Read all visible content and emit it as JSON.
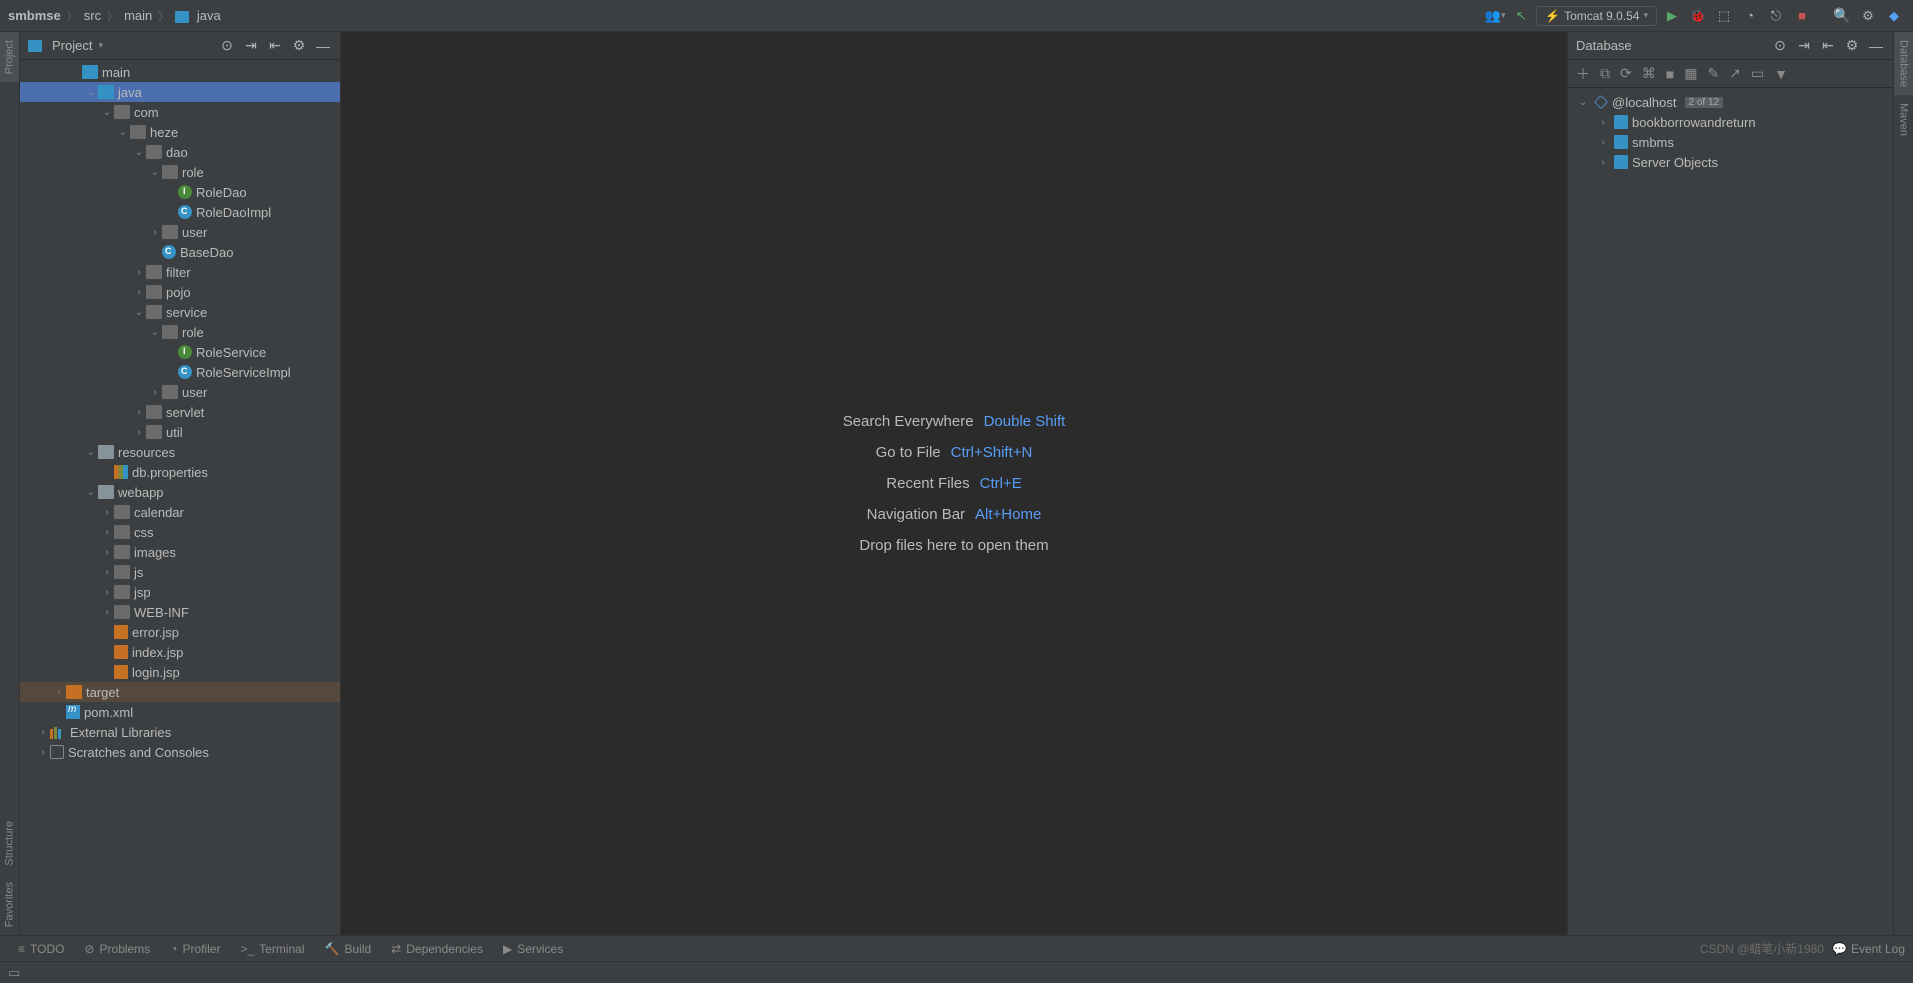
{
  "breadcrumb": {
    "project": "smbmse",
    "parts": [
      "src",
      "main"
    ],
    "current": "java"
  },
  "runConfig": {
    "label": "Tomcat 9.0.54"
  },
  "projectPanel": {
    "title": "Project",
    "tree": [
      {
        "label": "main",
        "indent": 3,
        "arrow": "",
        "iconCls": "icon-folder-blue",
        "hidden_top": true
      },
      {
        "label": "java",
        "indent": 4,
        "arrow": "v",
        "iconCls": "icon-folder-blue",
        "selected": true
      },
      {
        "label": "com",
        "indent": 5,
        "arrow": "v",
        "iconCls": "icon-folder-dark"
      },
      {
        "label": "heze",
        "indent": 6,
        "arrow": "v",
        "iconCls": "icon-folder-dark"
      },
      {
        "label": "dao",
        "indent": 7,
        "arrow": "v",
        "iconCls": "icon-folder-dark"
      },
      {
        "label": "role",
        "indent": 8,
        "arrow": "v",
        "iconCls": "icon-folder-dark"
      },
      {
        "label": "RoleDao",
        "indent": 9,
        "arrow": "",
        "iconCls": "icon-interface"
      },
      {
        "label": "RoleDaoImpl",
        "indent": 9,
        "arrow": "",
        "iconCls": "icon-class"
      },
      {
        "label": "user",
        "indent": 8,
        "arrow": ">",
        "iconCls": "icon-folder-dark"
      },
      {
        "label": "BaseDao",
        "indent": 8,
        "arrow": "",
        "iconCls": "icon-class"
      },
      {
        "label": "filter",
        "indent": 7,
        "arrow": ">",
        "iconCls": "icon-folder-dark"
      },
      {
        "label": "pojo",
        "indent": 7,
        "arrow": ">",
        "iconCls": "icon-folder-dark"
      },
      {
        "label": "service",
        "indent": 7,
        "arrow": "v",
        "iconCls": "icon-folder-dark"
      },
      {
        "label": "role",
        "indent": 8,
        "arrow": "v",
        "iconCls": "icon-folder-dark"
      },
      {
        "label": "RoleService",
        "indent": 9,
        "arrow": "",
        "iconCls": "icon-interface"
      },
      {
        "label": "RoleServiceImpl",
        "indent": 9,
        "arrow": "",
        "iconCls": "icon-class"
      },
      {
        "label": "user",
        "indent": 8,
        "arrow": ">",
        "iconCls": "icon-folder-dark"
      },
      {
        "label": "servlet",
        "indent": 7,
        "arrow": ">",
        "iconCls": "icon-folder-dark"
      },
      {
        "label": "util",
        "indent": 7,
        "arrow": ">",
        "iconCls": "icon-folder-dark"
      },
      {
        "label": "resources",
        "indent": 4,
        "arrow": "v",
        "iconCls": "icon-folder"
      },
      {
        "label": "db.properties",
        "indent": 5,
        "arrow": "",
        "iconCls": "icon-props"
      },
      {
        "label": "webapp",
        "indent": 4,
        "arrow": "v",
        "iconCls": "icon-folder"
      },
      {
        "label": "calendar",
        "indent": 5,
        "arrow": ">",
        "iconCls": "icon-folder-dark"
      },
      {
        "label": "css",
        "indent": 5,
        "arrow": ">",
        "iconCls": "icon-folder-dark"
      },
      {
        "label": "images",
        "indent": 5,
        "arrow": ">",
        "iconCls": "icon-folder-dark"
      },
      {
        "label": "js",
        "indent": 5,
        "arrow": ">",
        "iconCls": "icon-folder-dark"
      },
      {
        "label": "jsp",
        "indent": 5,
        "arrow": ">",
        "iconCls": "icon-folder-dark"
      },
      {
        "label": "WEB-INF",
        "indent": 5,
        "arrow": ">",
        "iconCls": "icon-folder-dark"
      },
      {
        "label": "error.jsp",
        "indent": 5,
        "arrow": "",
        "iconCls": "icon-jsp"
      },
      {
        "label": "index.jsp",
        "indent": 5,
        "arrow": "",
        "iconCls": "icon-jsp"
      },
      {
        "label": "login.jsp",
        "indent": 5,
        "arrow": "",
        "iconCls": "icon-jsp"
      },
      {
        "label": "target",
        "indent": 2,
        "arrow": ">",
        "iconCls": "icon-folder-orange",
        "highlighted": true
      },
      {
        "label": "pom.xml",
        "indent": 2,
        "arrow": "",
        "iconCls": "icon-maven"
      },
      {
        "label": "External Libraries",
        "indent": 1,
        "arrow": ">",
        "iconCls": "icon-lib"
      },
      {
        "label": "Scratches and Consoles",
        "indent": 1,
        "arrow": ">",
        "iconCls": "icon-scratch"
      }
    ]
  },
  "editorHints": [
    {
      "label": "Search Everywhere",
      "kbd": "Double Shift"
    },
    {
      "label": "Go to File",
      "kbd": "Ctrl+Shift+N"
    },
    {
      "label": "Recent Files",
      "kbd": "Ctrl+E"
    },
    {
      "label": "Navigation Bar",
      "kbd": "Alt+Home"
    },
    {
      "label": "Drop files here to open them",
      "kbd": ""
    }
  ],
  "databasePanel": {
    "title": "Database",
    "connection": "@localhost",
    "badge": "2 of 12",
    "items": [
      "bookborrowandreturn",
      "smbms",
      "Server Objects"
    ]
  },
  "leftGutter": [
    {
      "label": "Project",
      "active": true
    },
    {
      "label": "Structure",
      "active": false
    },
    {
      "label": "Favorites",
      "active": false
    }
  ],
  "rightGutter": [
    {
      "label": "Database"
    },
    {
      "label": "Maven"
    }
  ],
  "bottomTabs": [
    {
      "icon": "≡",
      "label": "TODO"
    },
    {
      "icon": "⊘",
      "label": "Problems"
    },
    {
      "icon": "◔",
      "label": "Profiler"
    },
    {
      "icon": ">_",
      "label": "Terminal"
    },
    {
      "icon": "🔨",
      "label": "Build"
    },
    {
      "icon": "⇄",
      "label": "Dependencies"
    },
    {
      "icon": "▶",
      "label": "Services"
    }
  ],
  "bottomRight": {
    "watermark": "CSDN @蜡笔小新1980",
    "eventLog": "Event Log"
  }
}
